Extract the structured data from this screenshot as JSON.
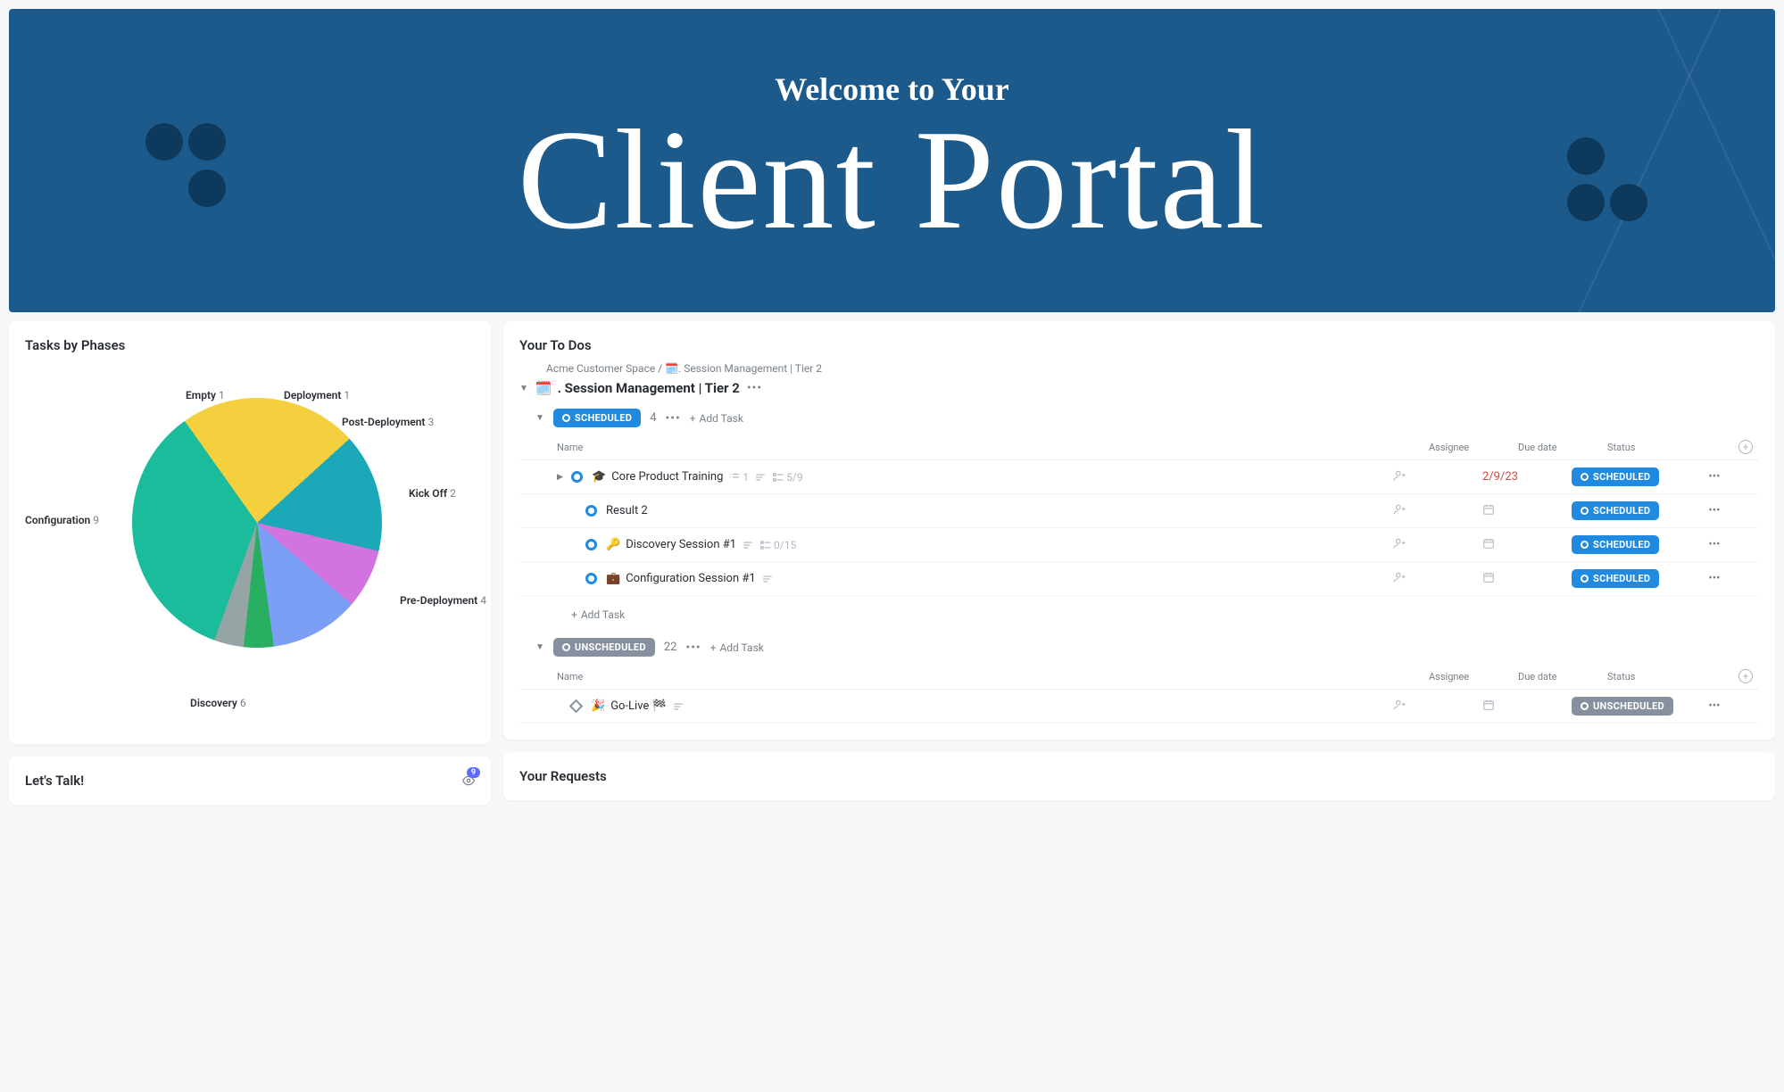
{
  "banner": {
    "subtitle": "Welcome to Your",
    "title": "Client Portal"
  },
  "panels": {
    "tasks_by_phases_title": "Tasks by Phases",
    "your_todos_title": "Your To Dos",
    "lets_talk_title": "Let's Talk!",
    "your_requests_title": "Your Requests",
    "eye_badge_count": "9"
  },
  "chart_data": {
    "type": "pie",
    "title": "Tasks by Phases",
    "data": [
      {
        "label": "Configuration",
        "value": 9,
        "color": "#1abc9c"
      },
      {
        "label": "Discovery",
        "value": 6,
        "color": "#f4d03f"
      },
      {
        "label": "Pre-Deployment",
        "value": 4,
        "color": "#1ba8b8"
      },
      {
        "label": "Kick Off",
        "value": 2,
        "color": "#d174e0"
      },
      {
        "label": "Post-Deployment",
        "value": 3,
        "color": "#7b9ff5"
      },
      {
        "label": "Deployment",
        "value": 1,
        "color": "#27ae60"
      },
      {
        "label": "Empty",
        "value": 1,
        "color": "#95a5a6"
      }
    ]
  },
  "todos": {
    "breadcrumb": "Acme Customer Space / 🗓️. Session Management | Tier 2",
    "section_icon": "🗓️",
    "section_title": ". Session Management | Tier 2",
    "add_task_label": "Add Task",
    "columns": {
      "name": "Name",
      "assignee": "Assignee",
      "due": "Due date",
      "status": "Status"
    },
    "groups": [
      {
        "status": "SCHEDULED",
        "style": "scheduled",
        "count": "4",
        "tasks": [
          {
            "icon": "🎓",
            "name": "Core Product Training",
            "has_caret": true,
            "sub_count": "1",
            "progress": "5/9",
            "due": "2/9/23",
            "overdue": true,
            "status": "SCHEDULED",
            "status_style": "scheduled",
            "has_desc": true
          },
          {
            "icon": "",
            "name": "Result 2",
            "sub": true,
            "status": "SCHEDULED",
            "status_style": "scheduled"
          },
          {
            "icon": "🔑",
            "name": "Discovery Session #1",
            "sub": true,
            "progress": "0/15",
            "status": "SCHEDULED",
            "status_style": "scheduled",
            "has_desc": true
          },
          {
            "icon": "💼",
            "name": "Configuration Session #1",
            "sub": true,
            "status": "SCHEDULED",
            "status_style": "scheduled",
            "has_desc": true
          }
        ]
      },
      {
        "status": "UNSCHEDULED",
        "style": "unscheduled",
        "count": "22",
        "tasks": [
          {
            "icon": "🎉",
            "name": "Go-Live 🏁",
            "diamond": true,
            "status": "UNSCHEDULED",
            "status_style": "unscheduled",
            "has_desc": true
          }
        ]
      }
    ]
  }
}
